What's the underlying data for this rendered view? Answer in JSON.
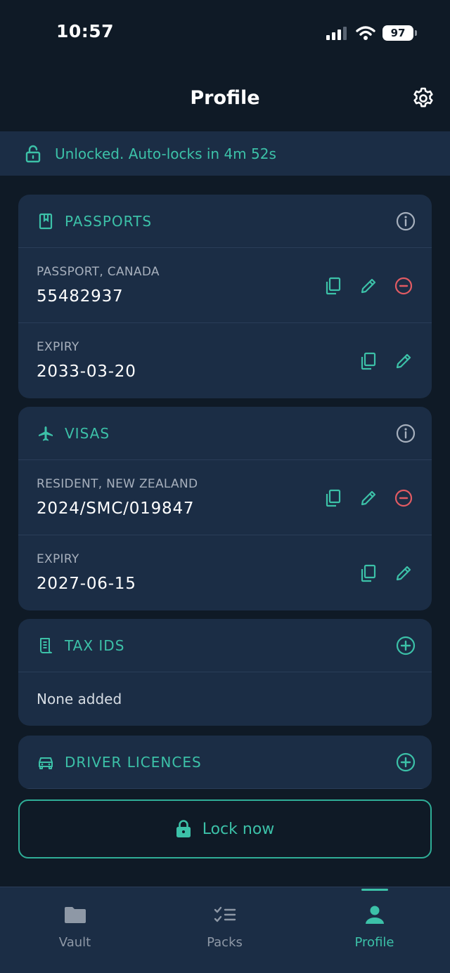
{
  "status_bar": {
    "time": "10:57",
    "battery": "97"
  },
  "header": {
    "title": "Profile"
  },
  "lock_banner": {
    "text": "Unlocked. Auto-locks in 4m 52s"
  },
  "sections": {
    "passports": {
      "title": "PASSPORTS",
      "rows": [
        {
          "label": "PASSPORT, CANADA",
          "value": "55482937"
        },
        {
          "label": "EXPIRY",
          "value": "2033-03-20"
        }
      ]
    },
    "visas": {
      "title": "VISAS",
      "rows": [
        {
          "label": "RESIDENT, NEW ZEALAND",
          "value": "2024/SMC/019847"
        },
        {
          "label": "EXPIRY",
          "value": "2027-06-15"
        }
      ]
    },
    "tax_ids": {
      "title": "TAX IDS",
      "empty_text": "None added"
    },
    "driver_licences": {
      "title": "DRIVER LICENCES"
    }
  },
  "lock_button": {
    "label": "Lock now"
  },
  "tab_bar": {
    "tabs": [
      {
        "label": "Vault"
      },
      {
        "label": "Packs"
      },
      {
        "label": "Profile"
      }
    ],
    "active": "Profile"
  },
  "colors": {
    "background": "#0f1a26",
    "card": "#1b2d45",
    "accent": "#3cc1a8",
    "danger": "#e25b63",
    "muted": "#a7b0bd"
  }
}
